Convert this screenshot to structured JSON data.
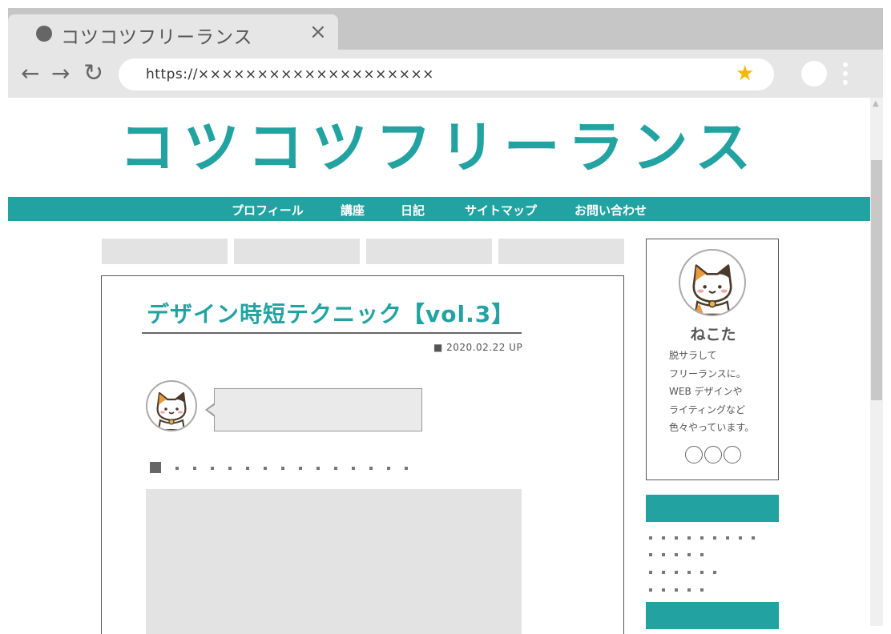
{
  "browser": {
    "tab_title": "コツコツフリーランス",
    "tab_close": "×",
    "back": "←",
    "forward": "→",
    "reload": "↻",
    "url": "https://××××××××××××××××××××",
    "bookmark_icon": "star-icon",
    "bookmark_glyph": "★",
    "star_color": "#f5b800"
  },
  "site": {
    "logo": "コツコツフリーランス",
    "accent_color": "#22a3a1",
    "nav": [
      "プロフィール",
      "講座",
      "日記",
      "サイトマップ",
      "お問い合わせ"
    ]
  },
  "article": {
    "title": "デザイン時短テクニック【vol.3】",
    "date": "■ 2020.02.22 UP"
  },
  "sidebar": {
    "name": "ねこた",
    "bio": [
      "脱サラして",
      "フリーランスに。",
      "WEB デザインや",
      "ライティングなど",
      "色々やっています。"
    ]
  }
}
